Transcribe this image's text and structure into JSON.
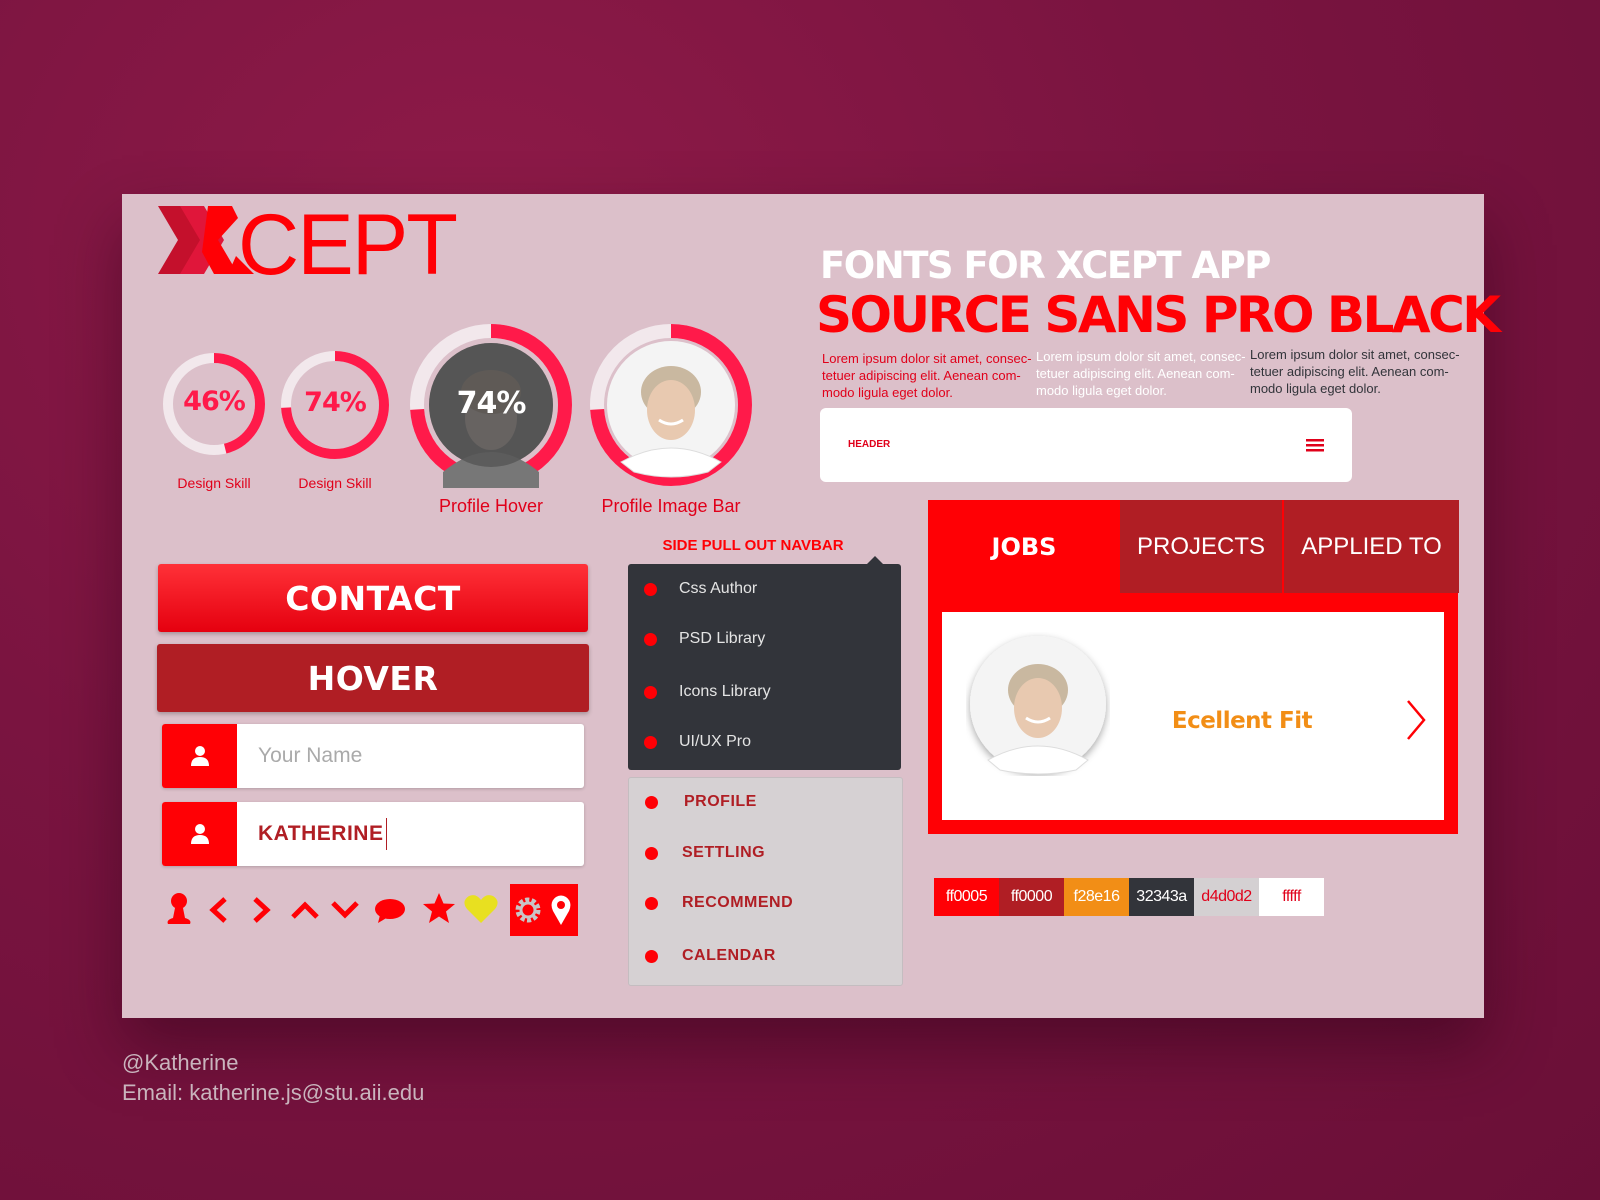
{
  "logo": {
    "text": "XCEPT"
  },
  "fonts": {
    "title": "FONTS FOR XCEPT APP",
    "font_name": "SOURCE SANS PRO BLACK",
    "lorem": [
      {
        "lines": [
          "Lorem ipsum dolor sit amet, consec-",
          "tetuer adipiscing elit. Aenean com-",
          "modo ligula eget dolor."
        ],
        "color": "#e0001a"
      },
      {
        "lines": [
          "Lorem ipsum dolor sit amet, consec-",
          "tetuer adipiscing elit. Aenean com-",
          "modo ligula eget dolor."
        ],
        "color": "#ffffff"
      },
      {
        "lines": [
          "Lorem ipsum dolor sit amet, consec-",
          "tetuer adipiscing elit. Aenean com-",
          "modo ligula eget dolor."
        ],
        "color": "#32343a"
      }
    ]
  },
  "header_card": {
    "label": "HEADER",
    "menu_icon": "hamburger-menu-icon"
  },
  "skills": [
    {
      "value": "46%",
      "fraction": 0.46,
      "label": "Design Skill"
    },
    {
      "value": "74%",
      "fraction": 0.74,
      "label": "Design Skill"
    }
  ],
  "profile_hover": {
    "value": "74%",
    "fraction": 0.74,
    "label": "Profile Hover"
  },
  "profile_image_bar": {
    "fraction": 0.74,
    "label": "Profile Image Bar"
  },
  "buttons": {
    "contact": "CONTACT",
    "hover": "HOVER"
  },
  "inputs": {
    "name_placeholder": "Your Name",
    "name_value": "KATHERINE"
  },
  "icon_row": [
    "user-icon",
    "chevron-left-icon",
    "chevron-right-icon",
    "chevron-up-icon",
    "chevron-down-icon",
    "chat-bubble-icon",
    "star-icon",
    "heart-icon",
    "gear-icon",
    "location-pin-icon"
  ],
  "side_nav": {
    "title": "SIDE PULL OUT NAVBAR",
    "dark_items": [
      "Css Author",
      "PSD Library",
      "Icons Library",
      "UI/UX Pro"
    ],
    "light_items": [
      "PROFILE",
      "SETTLING",
      "RECOMMEND",
      "CALENDAR"
    ]
  },
  "jobs_panel": {
    "tabs": [
      "JOBS",
      "PROJECTS",
      "APPLIED TO"
    ],
    "active_tab": "JOBS",
    "card_text": "Ecellent Fit",
    "arrow_icon": "chevron-right-icon"
  },
  "palette": [
    {
      "label": "ff0005",
      "bg": "#ff0005",
      "fg": "#ffffff"
    },
    {
      "label": "ff0000",
      "bg": "#b01e24",
      "fg": "#ffffff"
    },
    {
      "label": "f28e16",
      "bg": "#f28e16",
      "fg": "#ffffff"
    },
    {
      "label": "32343a",
      "bg": "#32343a",
      "fg": "#ffffff"
    },
    {
      "label": "d4d0d2",
      "bg": "#d4d0d2",
      "fg": "#e0001a"
    },
    {
      "label": "fffff",
      "bg": "#ffffff",
      "fg": "#e0001a"
    }
  ],
  "footer": {
    "handle": "@Katherine",
    "email": "Email: katherine.js@stu.aii.edu"
  }
}
